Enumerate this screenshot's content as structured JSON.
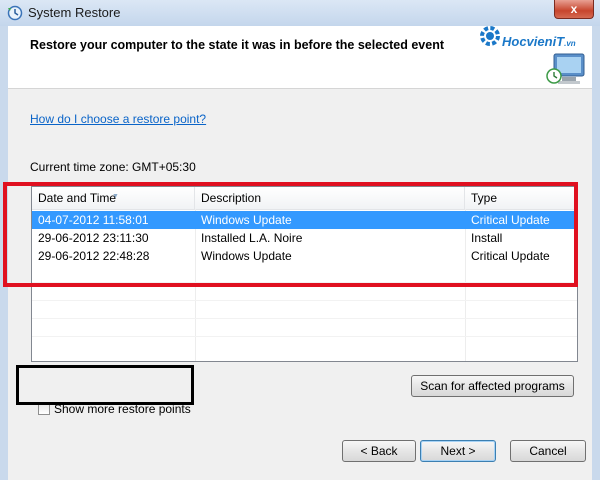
{
  "window": {
    "title": "System Restore",
    "close_label": "x"
  },
  "header": {
    "text": "Restore your computer to the state it was in before the selected event",
    "logo_text": "HocvieniT",
    "logo_suffix": ".vn"
  },
  "help_link": "How do I choose a restore point?",
  "timezone": "Current time zone: GMT+05:30",
  "table": {
    "columns": [
      "Date and Time",
      "Description",
      "Type"
    ],
    "rows": [
      {
        "date": "04-07-2012 11:58:01",
        "description": "Windows Update",
        "type": "Critical Update",
        "selected": true
      },
      {
        "date": "29-06-2012 23:11:30",
        "description": "Installed L.A. Noire",
        "type": "Install",
        "selected": false
      },
      {
        "date": "29-06-2012 22:48:28",
        "description": "Windows Update",
        "type": "Critical Update",
        "selected": false
      }
    ]
  },
  "show_more_label": "Show more restore points",
  "show_more_checked": false,
  "buttons": {
    "scan": "Scan for affected programs",
    "back": "< Back",
    "next": "Next >",
    "cancel": "Cancel"
  },
  "colors": {
    "selection": "#3399ff",
    "highlight_red": "#e01020",
    "link": "#0a64c8"
  }
}
